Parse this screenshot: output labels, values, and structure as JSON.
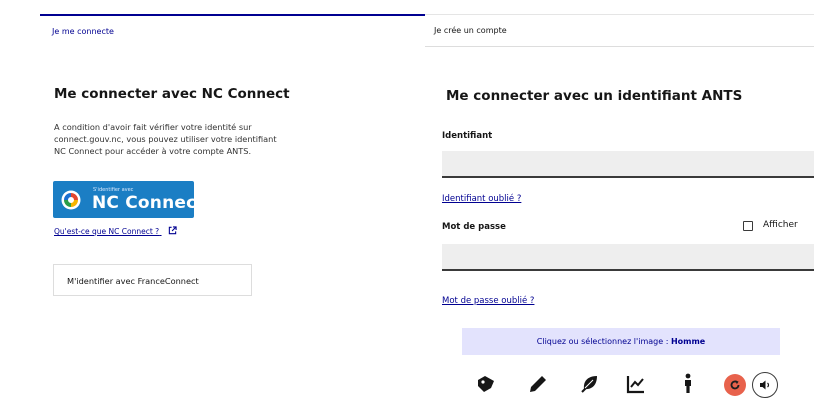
{
  "tabs": {
    "login": "Je me connecte",
    "create": "Je crée un compte"
  },
  "nc_panel": {
    "title": "Me connecter avec NC Connect",
    "description_lines": [
      "A condition d'avoir fait vérifier votre identité sur",
      "connect.gouv.nc, vous pouvez utiliser votre identifiant",
      "NC Connect pour accéder à votre compte ANTS."
    ],
    "nc_button_small": "S'identifier avec",
    "nc_button_big": "NC Connect",
    "what_is_link": "Qu'est-ce que NC Connect ?",
    "franceconnect_button": "M'identifier avec FranceConnect"
  },
  "ants_panel": {
    "title": "Me connecter avec un identifiant ANTS",
    "identifier_label": "Identifiant",
    "identifier_value": "",
    "forgot_identifier": "Identifiant oublié ?",
    "password_label": "Mot de passe",
    "password_value": "",
    "show_label": "Afficher",
    "show_checked": false,
    "forgot_password": "Mot de passe oublié ?",
    "captcha_prompt": "Cliquez ou sélectionnez l'image : ",
    "captcha_target": "Homme",
    "captcha_icons": [
      "tag-icon",
      "pen-icon",
      "leaf-icon",
      "chart-icon",
      "person-icon"
    ]
  },
  "colors": {
    "accent": "#000091",
    "nc_blue": "#1b7ec4",
    "captcha_bg": "#e3e3fd",
    "refresh": "#e8624c"
  }
}
